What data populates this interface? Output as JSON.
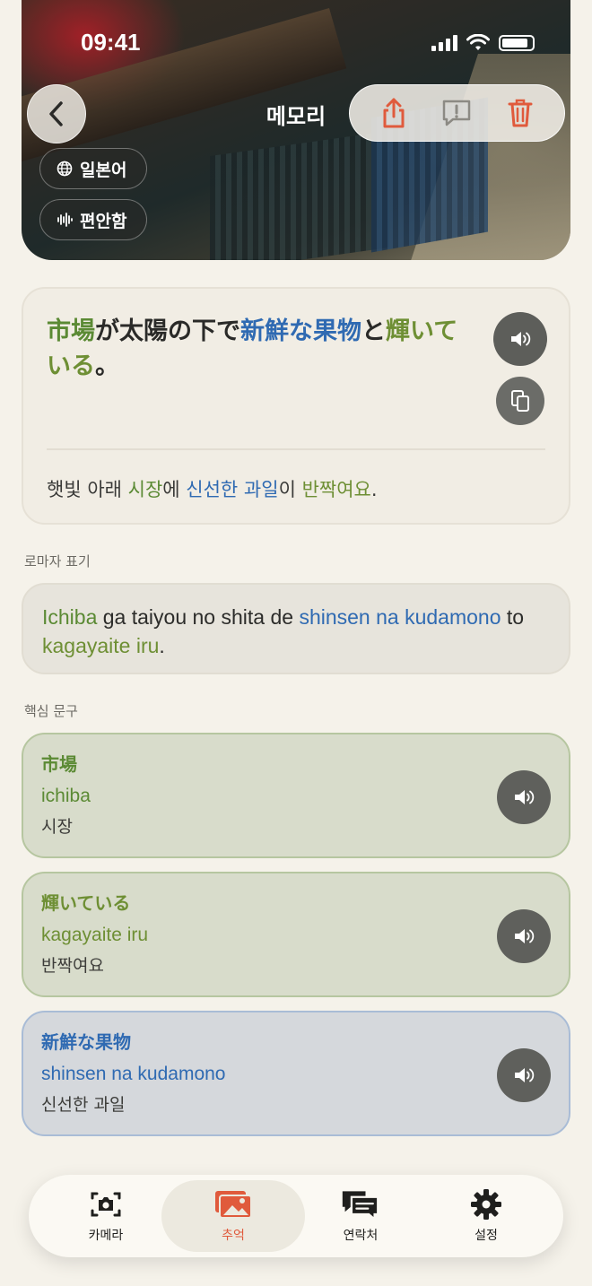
{
  "status": {
    "time": "09:41"
  },
  "nav": {
    "title": "메모리"
  },
  "chips": {
    "language": "일본어",
    "tone": "편안함"
  },
  "sentence": {
    "jp_parts": [
      {
        "text": "市場",
        "color": "green"
      },
      {
        "text": "が太陽の下で",
        "color": "default"
      },
      {
        "text": "新鮮な果物",
        "color": "blue"
      },
      {
        "text": "と",
        "color": "default"
      },
      {
        "text": "輝いている",
        "color": "olive"
      },
      {
        "text": "。",
        "color": "default"
      }
    ],
    "ko_parts": [
      {
        "text": "햇빛 아래 ",
        "color": "default"
      },
      {
        "text": "시장",
        "color": "green"
      },
      {
        "text": "에 ",
        "color": "default"
      },
      {
        "text": "신선한 과일",
        "color": "blue"
      },
      {
        "text": "이 ",
        "color": "default"
      },
      {
        "text": "반짝여요",
        "color": "olive"
      },
      {
        "text": ".",
        "color": "default"
      }
    ]
  },
  "romaji": {
    "label": "로마자 표기",
    "parts": [
      {
        "text": "Ichiba",
        "color": "green"
      },
      {
        "text": " ga taiyou no shita de ",
        "color": "default"
      },
      {
        "text": "shinsen na kudamono",
        "color": "blue"
      },
      {
        "text": " to ",
        "color": "default"
      },
      {
        "text": "kagayaite iru",
        "color": "olive"
      },
      {
        "text": ".",
        "color": "default"
      }
    ]
  },
  "key_phrases": {
    "label": "핵심 문구",
    "items": [
      {
        "jp": "市場",
        "roma": "ichiba",
        "ko": "시장",
        "color": "green"
      },
      {
        "jp": "輝いている",
        "roma": "kagayaite iru",
        "ko": "반짝여요",
        "color": "olive"
      },
      {
        "jp": "新鮮な果物",
        "roma": "shinsen na kudamono",
        "ko": "신선한 과일",
        "color": "blue"
      }
    ]
  },
  "tabs": [
    {
      "label": "카메라",
      "icon": "camera-icon",
      "active": false
    },
    {
      "label": "추억",
      "icon": "photos-icon",
      "active": true
    },
    {
      "label": "연락처",
      "icon": "chat-icon",
      "active": false
    },
    {
      "label": "설정",
      "icon": "gear-icon",
      "active": false
    }
  ],
  "colors": {
    "green": "#5b8a34",
    "blue": "#2f6ab2",
    "olive": "#6e8f34",
    "accent_red": "#e05a3c"
  }
}
